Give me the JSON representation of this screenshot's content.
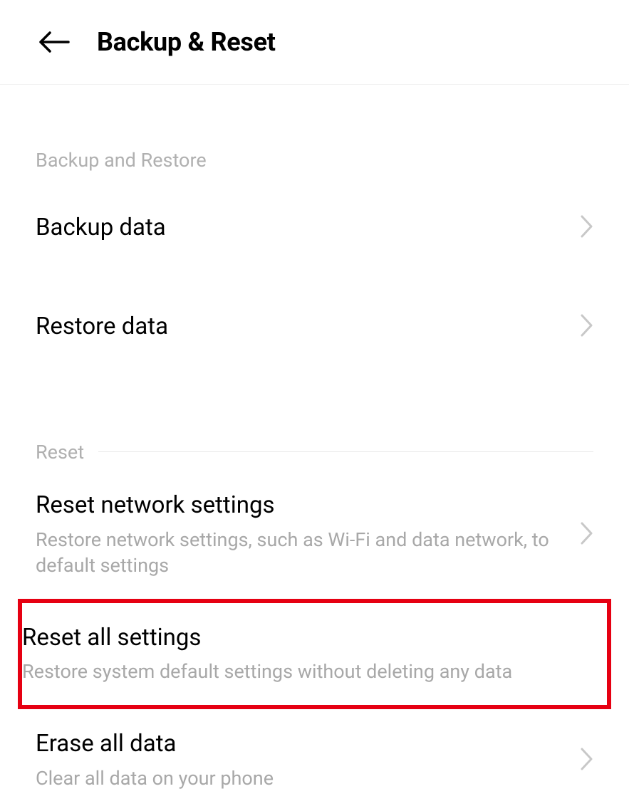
{
  "header": {
    "title": "Backup & Reset"
  },
  "sections": {
    "backup_restore": {
      "header": "Backup and Restore",
      "items": [
        {
          "title": "Backup data"
        },
        {
          "title": "Restore data"
        }
      ]
    },
    "reset": {
      "header": "Reset",
      "items": [
        {
          "title": "Reset network settings",
          "subtitle": "Restore network settings, such as Wi-Fi and data network, to default settings"
        },
        {
          "title": "Reset all settings",
          "subtitle": "Restore system default settings without deleting any data"
        },
        {
          "title": "Erase all data",
          "subtitle": "Clear all data on your phone"
        }
      ]
    }
  }
}
